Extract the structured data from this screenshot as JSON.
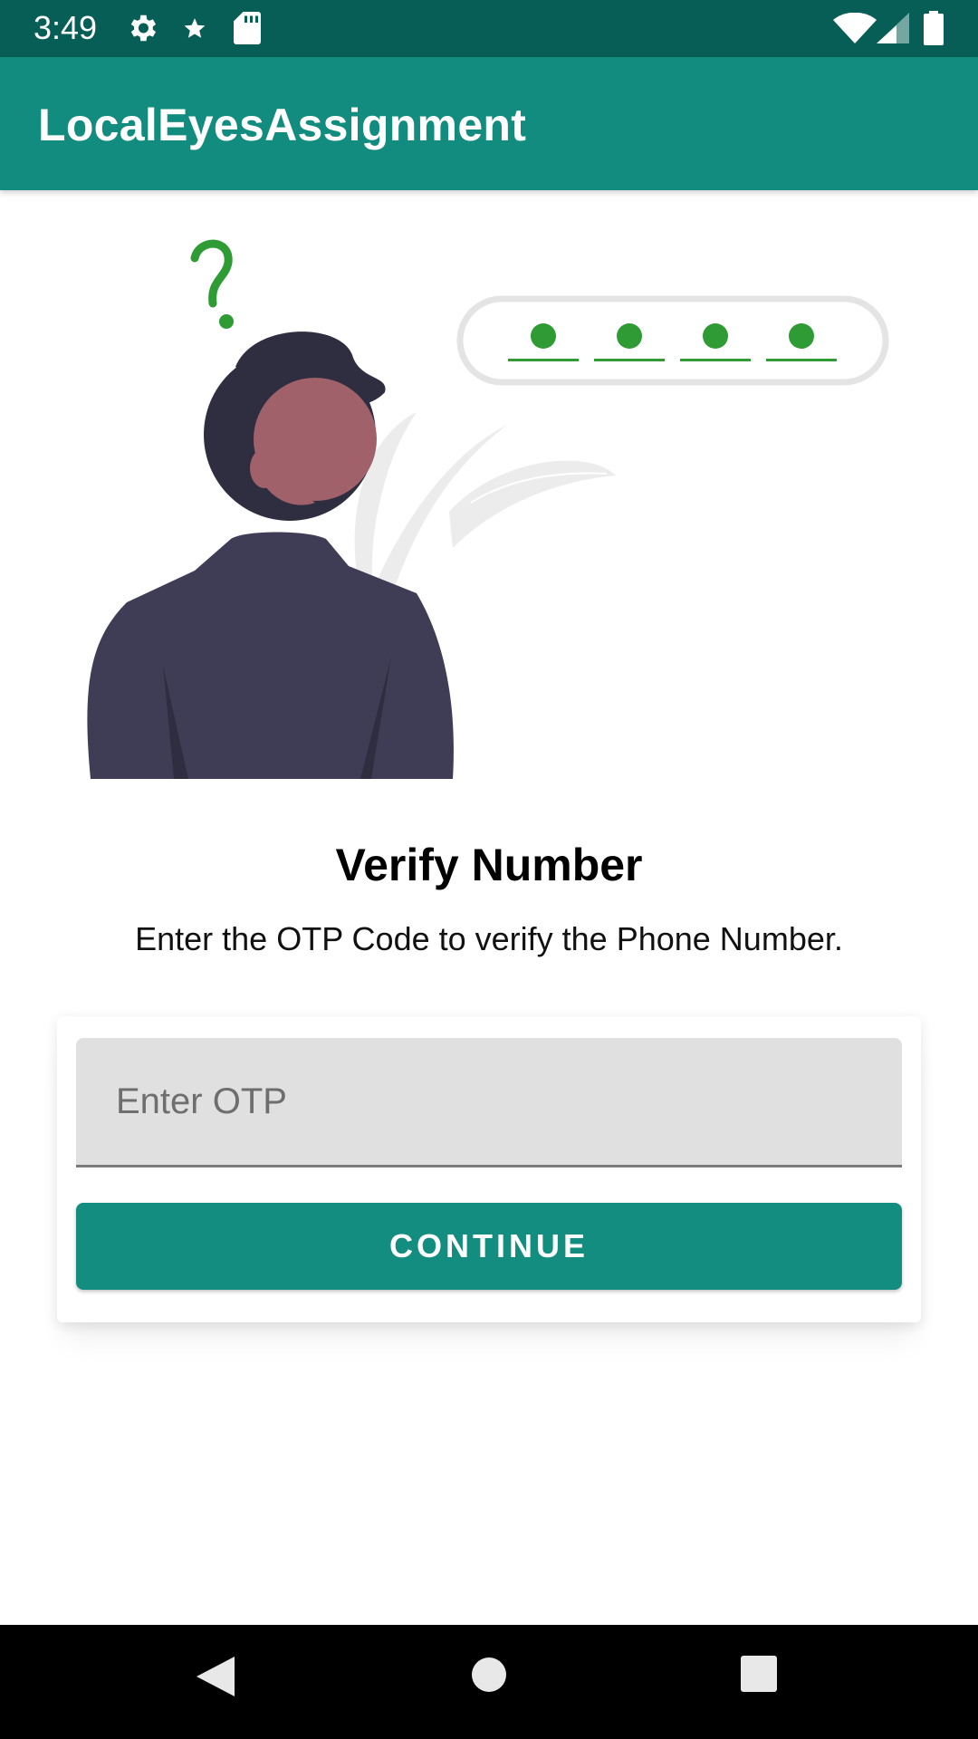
{
  "status_bar": {
    "time": "3:49",
    "icons_left": [
      "settings-gear-icon",
      "star-icon",
      "sd-card-icon"
    ],
    "icons_right": [
      "wifi-icon",
      "signal-icon",
      "battery-icon"
    ]
  },
  "app_bar": {
    "title": "LocalEyesAssignment"
  },
  "illustration": {
    "question_mark": "?",
    "otp_dot_count": 4
  },
  "content": {
    "heading": "Verify Number",
    "subtext": "Enter the OTP Code to verify the Phone Number."
  },
  "form": {
    "otp_placeholder": "Enter OTP",
    "otp_value": "",
    "continue_label": "CONTINUE"
  },
  "nav_bar": {
    "buttons": [
      "back-icon",
      "home-icon",
      "recents-icon"
    ]
  },
  "colors": {
    "status_bar": "#075e56",
    "app_bar": "#128c7e",
    "accent_green": "#2e9b34",
    "button": "#138d7f"
  }
}
